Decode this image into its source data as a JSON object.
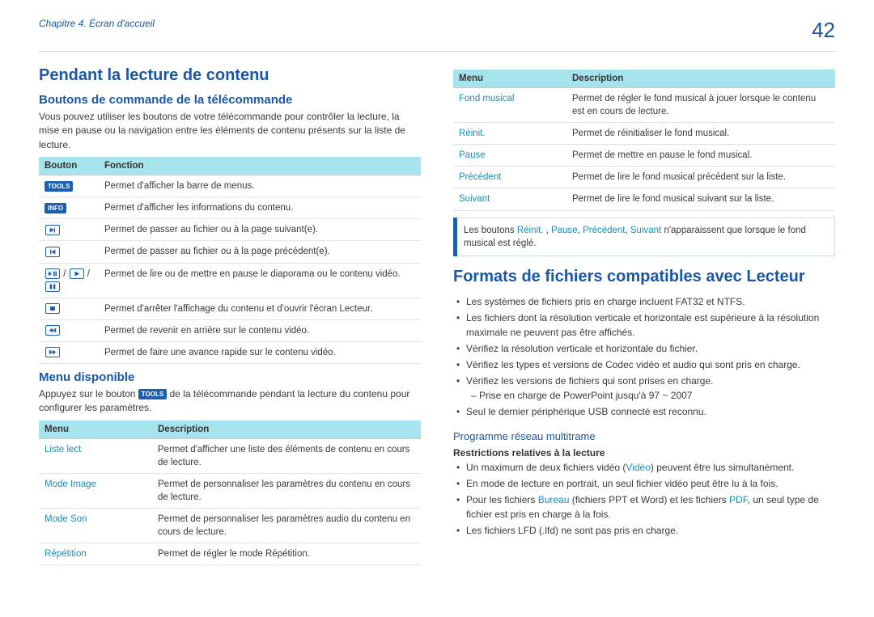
{
  "header": {
    "chapter": "Chapitre 4. Écran d'accueil",
    "page_number": "42"
  },
  "left": {
    "h1": "Pendant la lecture de contenu",
    "sec1": {
      "title": "Boutons de commande de la télécommande",
      "desc": "Vous pouvez utiliser les boutons de votre télécommande pour contrôler la lecture, la mise en pause ou la navigation entre les éléments de contenu présents sur la liste de lecture.",
      "th1": "Bouton",
      "th2": "Fonction",
      "rows": [
        {
          "btn_type": "pill",
          "btn_text": "TOOLS",
          "fn": "Permet d'afficher la barre de menus."
        },
        {
          "btn_type": "pill",
          "btn_text": "INFO",
          "fn": "Permet d'afficher les informations du contenu."
        },
        {
          "btn_type": "skip_fwd",
          "fn": "Permet de passer au fichier ou à la page suivant(e)."
        },
        {
          "btn_type": "skip_back",
          "fn": "Permet de passer au fichier ou à la page précédent(e)."
        },
        {
          "btn_type": "play_pause_group",
          "fn": "Permet de lire ou de mettre en pause le diaporama ou le contenu vidéo."
        },
        {
          "btn_type": "stop",
          "fn": "Permet d'arrêter l'affichage du contenu et d'ouvrir l'écran Lecteur."
        },
        {
          "btn_type": "rewind",
          "fn": "Permet de revenir en arrière sur le contenu vidéo."
        },
        {
          "btn_type": "ffwd",
          "fn": "Permet de faire une avance rapide sur le contenu vidéo."
        }
      ]
    },
    "sec2": {
      "title": "Menu disponible",
      "desc_before": "Appuyez sur le bouton ",
      "pill": "TOOLS",
      "desc_after": " de la télécommande pendant la lecture du contenu pour configurer les paramètres.",
      "th1": "Menu",
      "th2": "Description",
      "rows": [
        {
          "menu": "Liste lect",
          "desc": "Permet d'afficher une liste des éléments de contenu en cours de lecture."
        },
        {
          "menu": "Mode Image",
          "desc": "Permet de personnaliser les paramètres du contenu en cours de lecture."
        },
        {
          "menu": "Mode Son",
          "desc": "Permet de personnaliser les paramètres audio du contenu en cours de lecture."
        },
        {
          "menu": "Répétition",
          "desc": "Permet de régler le mode Répétition."
        }
      ]
    }
  },
  "right": {
    "table_top": {
      "th1": "Menu",
      "th2": "Description",
      "rows": [
        {
          "menu": "Fond musical",
          "desc": "Permet de régler le fond musical à jouer lorsque le contenu est en cours de lecture."
        },
        {
          "menu": "Réinit.",
          "desc": "Permet de réinitialiser le fond musical."
        },
        {
          "menu": "Pause",
          "desc": "Permet de mettre en pause le fond musical."
        },
        {
          "menu": "Précédent",
          "desc": "Permet de lire le fond musical précédent sur la liste."
        },
        {
          "menu": "Suivant",
          "desc": "Permet de lire le fond musical suivant sur la liste."
        }
      ]
    },
    "note": {
      "before": "Les boutons ",
      "k1": "Réinit.",
      "sep1": " , ",
      "k2": "Pause",
      "sep2": ", ",
      "k3": "Précédent",
      "sep3": ", ",
      "k4": "Suivant",
      "after": " n'apparaissent que lorsque le fond musical est réglé."
    },
    "h2": "Formats de fichiers compatibles avec Lecteur",
    "bullets": [
      "Les systèmes de fichiers pris en charge incluent FAT32 et NTFS.",
      "Les fichiers dont la résolution verticale et horizontale est supérieure à la résolution maximale ne peuvent pas être affichés.",
      "Vérifiez la résolution verticale et horizontale du fichier.",
      "Vérifiez les types et versions de Codec vidéo et audio qui sont pris en charge.",
      "Vérifiez les versions de fichiers qui sont prises en charge.",
      "Seul le dernier périphérique USB connecté est reconnu."
    ],
    "sub_bullet": "Prise en charge de PowerPoint jusqu'à 97 ~ 2007",
    "sec3": {
      "title": "Programme réseau multitrame",
      "sub": "Restrictions relatives à la lecture",
      "b1_before": "Un maximum de deux fichiers vidéo (",
      "b1_link": "Vidéo",
      "b1_after": ") peuvent être lus simultanément.",
      "b2": "En mode de lecture en portrait, un seul fichier vidéo peut être lu à la fois.",
      "b3_before": "Pour les fichiers ",
      "b3_link1": "Bureau",
      "b3_mid": " (fichiers PPT et Word) et les fichiers ",
      "b3_link2": "PDF",
      "b3_after": ", un seul type de fichier est pris en charge à la fois.",
      "b4": "Les fichiers LFD (.lfd) ne sont pas pris en charge."
    }
  }
}
